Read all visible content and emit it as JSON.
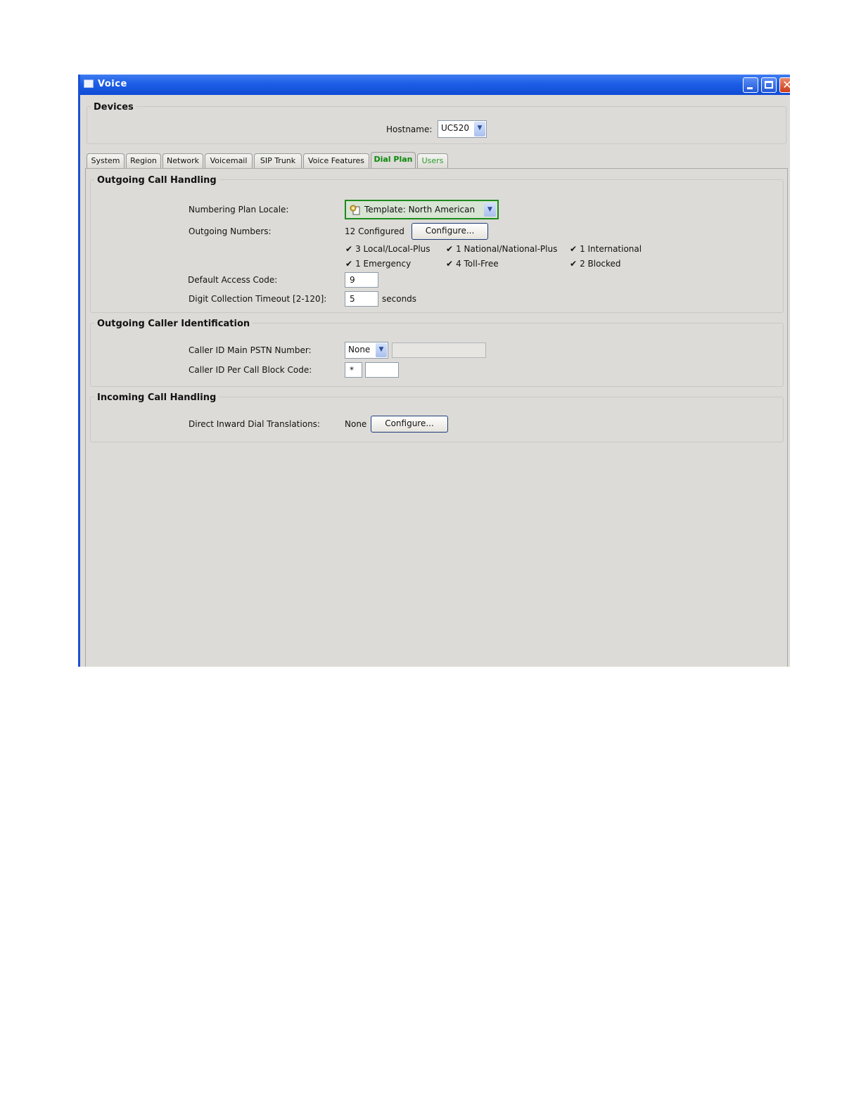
{
  "window": {
    "title": "Voice",
    "close_glyph": "✕"
  },
  "devices": {
    "legend": "Devices",
    "hostname_label": "Hostname:",
    "hostname_value": "UC520"
  },
  "tabs": [
    {
      "label": "System"
    },
    {
      "label": "Region"
    },
    {
      "label": "Network"
    },
    {
      "label": "Voicemail"
    },
    {
      "label": "SIP Trunk"
    },
    {
      "label": "Voice Features"
    },
    {
      "label": "Dial Plan"
    },
    {
      "label": "Users"
    }
  ],
  "outgoing_call_handling": {
    "legend": "Outgoing Call Handling",
    "locale_label": "Numbering Plan Locale:",
    "locale_value": "Template: North American",
    "outgoing_numbers_label": "Outgoing Numbers:",
    "outgoing_numbers_value": "12 Configured",
    "configure_label": "Configure...",
    "checks": [
      "3 Local/Local-Plus",
      "1 National/National-Plus",
      "1 International",
      "1 Emergency",
      "4 Toll-Free",
      "2 Blocked"
    ],
    "access_code_label": "Default Access Code:",
    "access_code_value": "9",
    "timeout_label": "Digit Collection Timeout [2-120]:",
    "timeout_value": "5",
    "timeout_unit": "seconds"
  },
  "outgoing_caller_id": {
    "legend": "Outgoing Caller Identification",
    "main_pstn_label": "Caller ID Main PSTN Number:",
    "main_pstn_select": "None",
    "main_pstn_value": "",
    "block_code_label": "Caller ID Per Call Block Code:",
    "block_code_prefix": "*",
    "block_code_value": ""
  },
  "incoming_call_handling": {
    "legend": "Incoming Call Handling",
    "did_label": "Direct Inward Dial Translations:",
    "did_value": "None",
    "configure_label": "Configure..."
  },
  "icons": {
    "check": "✔",
    "dropdown": "▼"
  },
  "colors": {
    "titlebar": "#1d5ee6",
    "active_tab": "#0a8a0a",
    "window_bg": "#dcdbd7"
  }
}
